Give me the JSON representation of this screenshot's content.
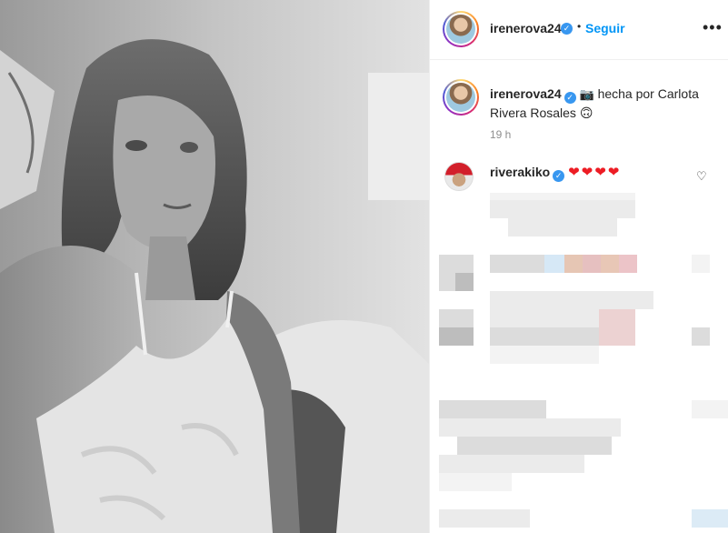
{
  "post": {
    "author": "irenerova24",
    "verified_mark": "✓",
    "separator": "•",
    "follow_label": "Seguir",
    "more_label": "•••",
    "caption_author": "irenerova24",
    "caption_icon": "📷",
    "caption_text": "hecha por Carlota Rivera Rosales",
    "caption_emoji": "🙃",
    "time_ago": "19 h"
  },
  "comments": [
    {
      "author": "riverakiko",
      "verified_mark": "✓",
      "text": "❤❤❤❤",
      "like_icon": "heart-outline-icon",
      "like_glyph": "♡"
    }
  ],
  "colors": {
    "link_blue": "#0095f6",
    "verified_blue": "#3897f0",
    "text": "#262626",
    "muted": "#8e8e8e",
    "heart_red": "#ed1c24"
  }
}
